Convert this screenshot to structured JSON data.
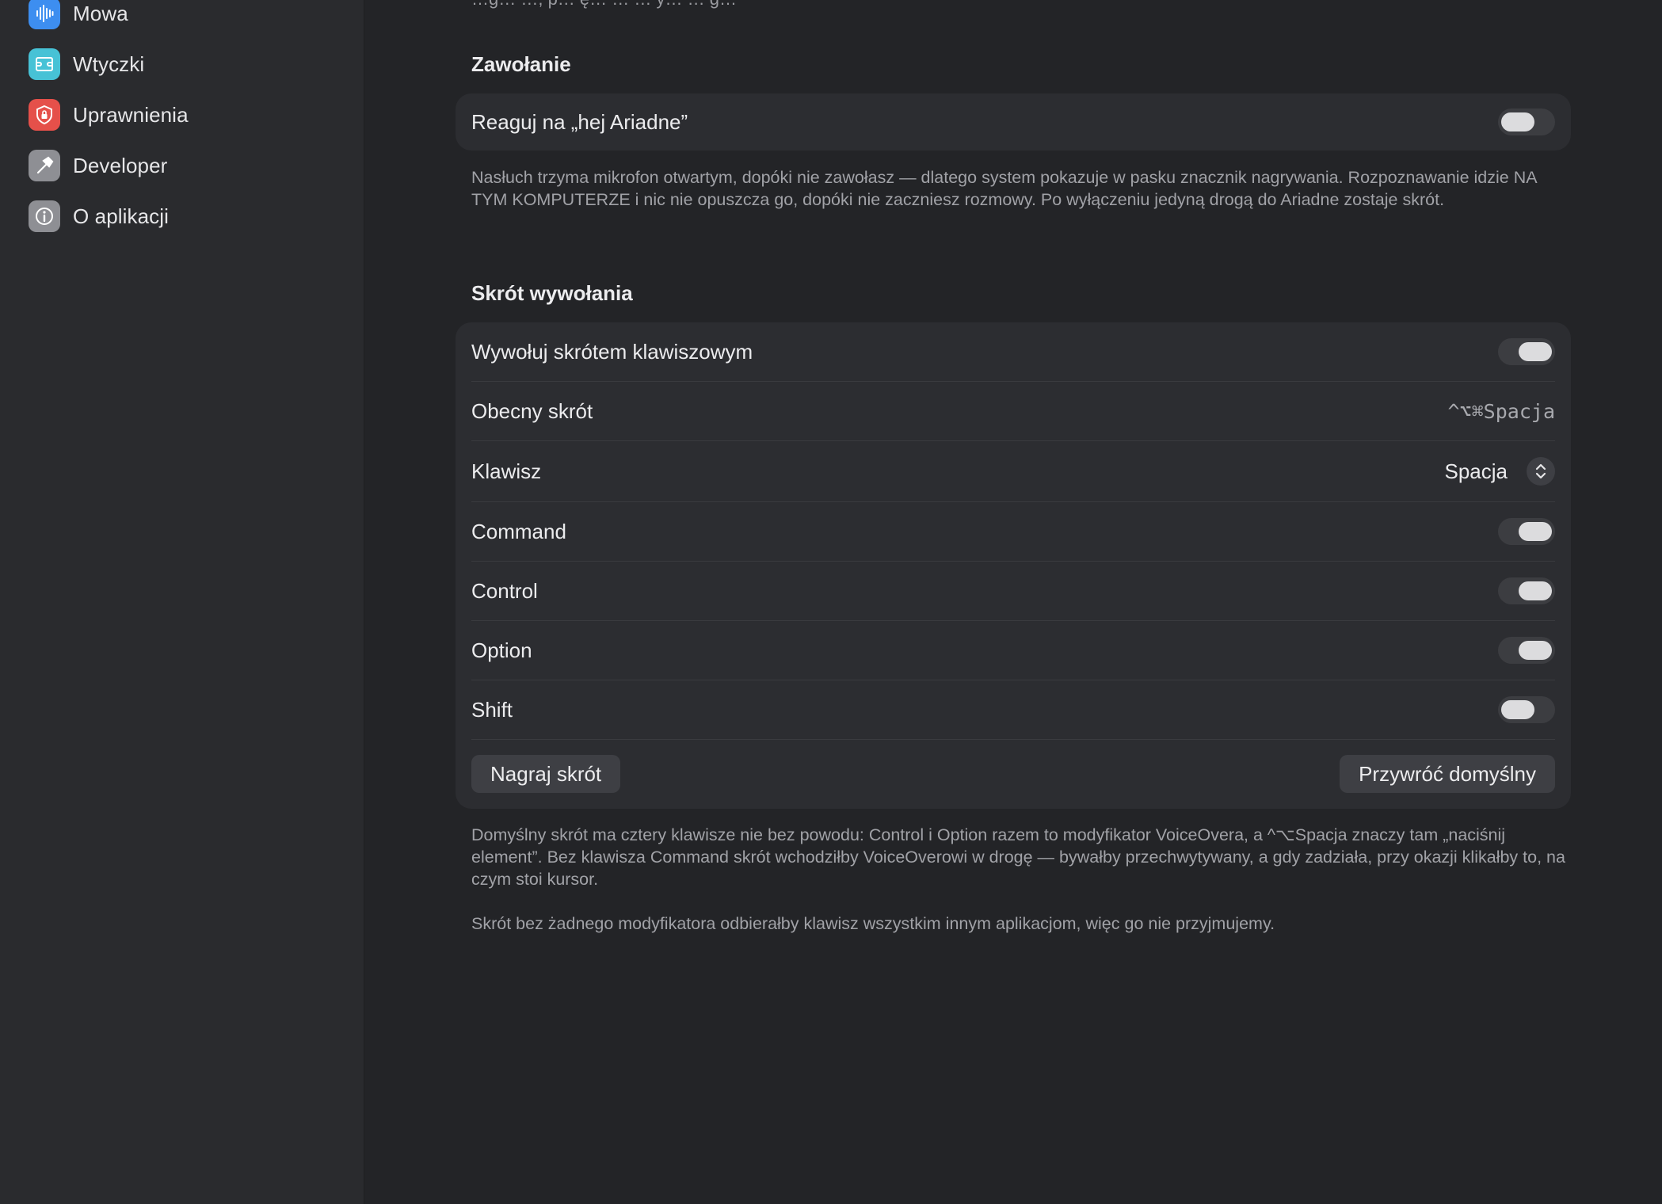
{
  "sidebar": {
    "items": [
      {
        "label": "Mowa",
        "icon": "waveform-icon",
        "color": "#3d8ef0"
      },
      {
        "label": "Wtyczki",
        "icon": "plugin-icon",
        "color": "#47c2d6"
      },
      {
        "label": "Uprawnienia",
        "icon": "shield-lock-icon",
        "color": "#e5504a"
      },
      {
        "label": "Developer",
        "icon": "hammer-icon",
        "color": "#8e8f94"
      },
      {
        "label": "O aplikacji",
        "icon": "info-icon",
        "color": "#8e8f94"
      }
    ]
  },
  "main": {
    "top_clipped_text": "…g… …, p… ę… … … y… … g…",
    "invocation": {
      "title": "Zawołanie",
      "wake_word_label": "Reaguj na „hej Ariadne”",
      "wake_word_enabled": false,
      "help": "Nasłuch trzyma mikrofon otwartym, dopóki nie zawołasz — dlatego system pokazuje w pasku znacznik nagrywania. Rozpoznawanie idzie NA TYM KOMPUTERZE i nic nie opuszcza go, dopóki nie zaczniesz rozmowy. Po wyłączeniu jedyną drogą do Ariadne zostaje skrót."
    },
    "shortcut": {
      "title": "Skrót wywołania",
      "enable_label": "Wywołuj skrótem klawiszowym",
      "enable_on": true,
      "current_label": "Obecny skrót",
      "current_value": "^⌥⌘Spacja",
      "key_label": "Klawisz",
      "key_value": "Spacja",
      "modifiers": [
        {
          "label": "Command",
          "on": true
        },
        {
          "label": "Control",
          "on": true
        },
        {
          "label": "Option",
          "on": true
        },
        {
          "label": "Shift",
          "on": false
        }
      ],
      "record_button": "Nagraj skrót",
      "reset_button": "Przywróć domyślny",
      "help1": "Domyślny skrót ma cztery klawisze nie bez powodu: Control i Option razem to modyfikator VoiceOvera, a ^⌥Spacja znaczy tam „naciśnij element”. Bez klawisza Command skrót wchodziłby VoiceOverowi w drogę — bywałby przechwytywany, a gdy zadziała, przy okazji klikałby to, na czym stoi kursor.",
      "help2": "Skrót bez żadnego modyfikatora odbierałby klawisz wszystkim innym aplikacjom, więc go nie przyjmujemy."
    }
  }
}
